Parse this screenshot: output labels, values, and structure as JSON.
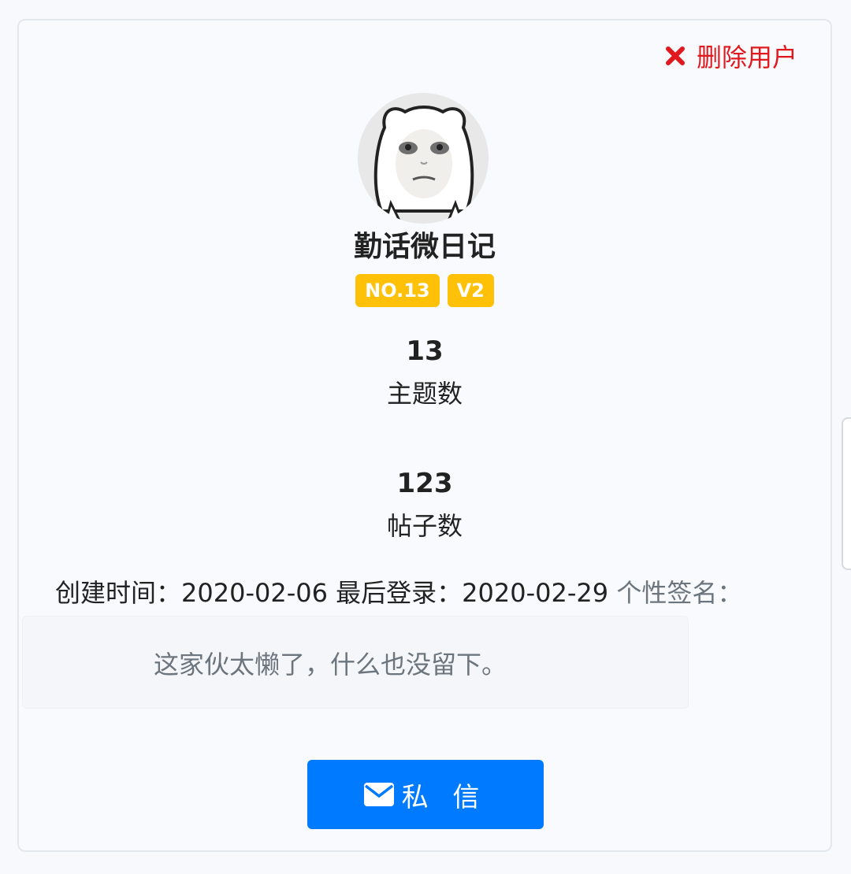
{
  "actions": {
    "delete_user": "删除用户",
    "private_message": "私 信"
  },
  "profile": {
    "username": "勤话微日记",
    "badges": [
      "NO.13",
      "V2"
    ]
  },
  "stats": {
    "topics_count": "13",
    "topics_label": "主题数",
    "posts_count": "123",
    "posts_label": "帖子数"
  },
  "info": {
    "created_label": "创建时间：",
    "created_date": "2020-02-06",
    "last_login_label": "最后登录：",
    "last_login_date": "2020-02-29",
    "signature_label": "个性签名："
  },
  "signature": {
    "text": "这家伙太懒了，什么也没留下。"
  },
  "colors": {
    "delete": "#e0191e",
    "badge": "#ffc107",
    "primary_button": "#007bff"
  },
  "icons": {
    "delete": "close-icon",
    "message": "envelope-icon"
  }
}
